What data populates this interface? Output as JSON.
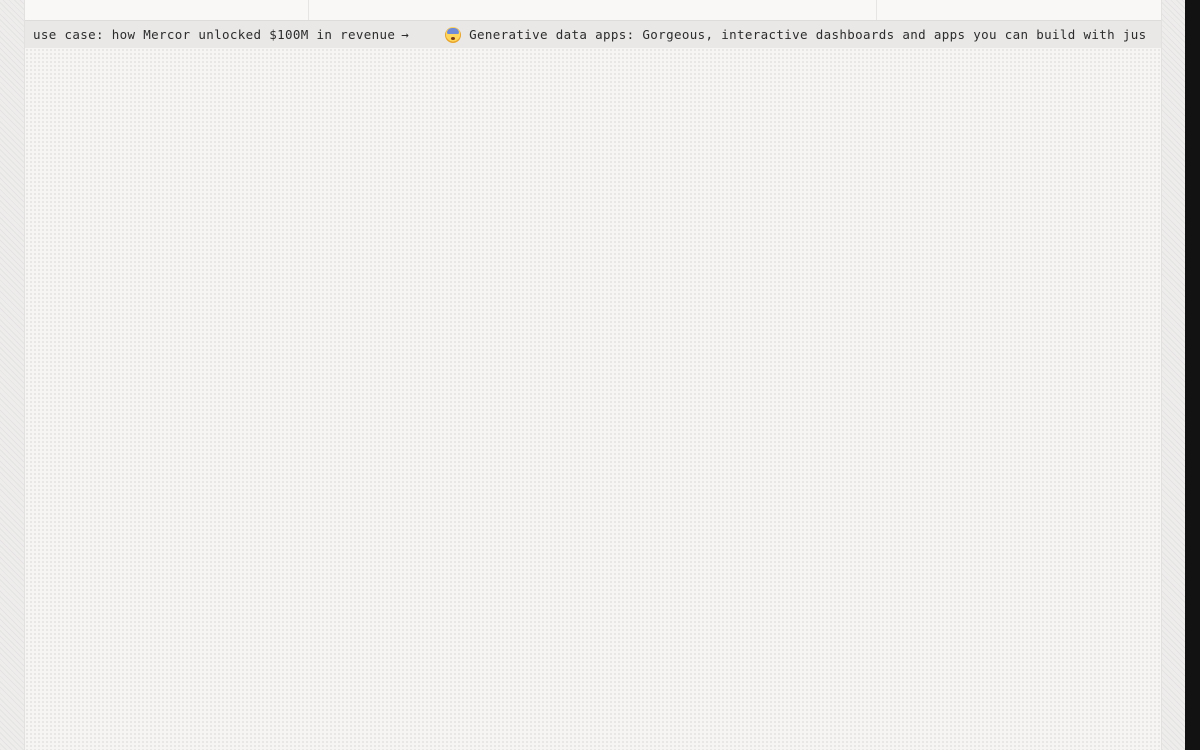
{
  "announcement_bar": {
    "items": [
      {
        "text": "use case: how Mercor unlocked $100M in revenue",
        "arrow": "→"
      },
      {
        "icon": "exploding-head-emoji-icon",
        "text": "Generative data apps: Gorgeous, interactive dashboards and apps you can build with jus"
      }
    ]
  },
  "colors": {
    "background": "#f6f5f4",
    "ticker_background": "#e9e8e7",
    "text": "#2c2c2c",
    "scrollbar": "#121212"
  }
}
